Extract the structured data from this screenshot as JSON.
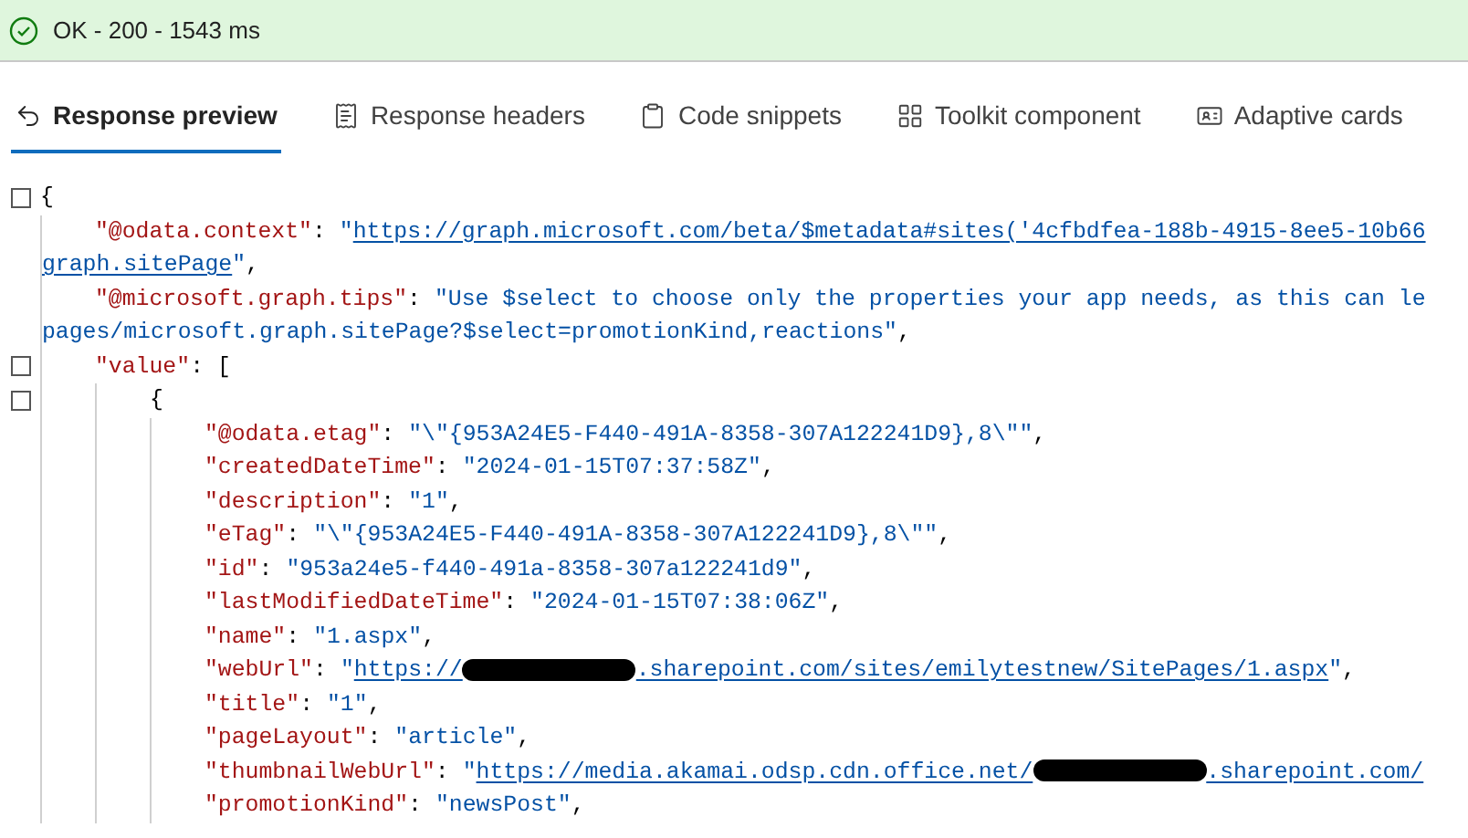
{
  "status": {
    "kind": "success",
    "text": "OK - 200 - 1543 ms"
  },
  "tabs": [
    {
      "label": "Response preview",
      "selected": true
    },
    {
      "label": "Response headers",
      "selected": false
    },
    {
      "label": "Code snippets",
      "selected": false
    },
    {
      "label": "Toolkit component",
      "selected": false
    },
    {
      "label": "Adaptive cards",
      "selected": false
    }
  ],
  "response": {
    "open": "{",
    "collapsible": true,
    "children": [
      {
        "key": "\"@odata.context\"",
        "sep": ":",
        "value": [
          {
            "kind": "string",
            "text": "\""
          },
          {
            "kind": "link",
            "parts": [
              {
                "kind": "text",
                "text": "https://graph.microsoft.com/beta/$metadata#sites('4cfbdfea-188b-4915-8ee5-10b66"
              }
            ]
          }
        ],
        "wrap": [
          {
            "kind": "link",
            "parts": [
              {
                "kind": "text",
                "text": "graph.sitePage"
              }
            ]
          },
          {
            "kind": "string",
            "text": "\""
          },
          {
            "kind": "punct",
            "text": ","
          }
        ]
      },
      {
        "key": "\"@microsoft.graph.tips\"",
        "sep": ":",
        "value": [
          {
            "kind": "string",
            "text": "\"Use $select to choose only the properties your app needs, as this can le"
          }
        ],
        "wrap": [
          {
            "kind": "string",
            "text": "pages/microsoft.graph.sitePage?$select=promotionKind,reactions\""
          },
          {
            "kind": "punct",
            "text": ","
          }
        ]
      },
      {
        "key": "\"value\"",
        "sep": ":",
        "open": "[",
        "collapsible": true,
        "children": [
          {
            "open": "{",
            "collapsible": true,
            "children": [
              {
                "key": "\"@odata.etag\"",
                "sep": ":",
                "value": [
                  {
                    "kind": "string",
                    "text": "\"\\\"{953A24E5-F440-491A-8358-307A122241D9},8\\\"\""
                  },
                  {
                    "kind": "punct",
                    "text": ","
                  }
                ]
              },
              {
                "key": "\"createdDateTime\"",
                "sep": ":",
                "value": [
                  {
                    "kind": "string",
                    "text": "\"2024-01-15T07:37:58Z\""
                  },
                  {
                    "kind": "punct",
                    "text": ","
                  }
                ]
              },
              {
                "key": "\"description\"",
                "sep": ":",
                "value": [
                  {
                    "kind": "string",
                    "text": "\"1\""
                  },
                  {
                    "kind": "punct",
                    "text": ","
                  }
                ]
              },
              {
                "key": "\"eTag\"",
                "sep": ":",
                "value": [
                  {
                    "kind": "string",
                    "text": "\"\\\"{953A24E5-F440-491A-8358-307A122241D9},8\\\"\""
                  },
                  {
                    "kind": "punct",
                    "text": ","
                  }
                ]
              },
              {
                "key": "\"id\"",
                "sep": ":",
                "value": [
                  {
                    "kind": "string",
                    "text": "\"953a24e5-f440-491a-8358-307a122241d9\""
                  },
                  {
                    "kind": "punct",
                    "text": ","
                  }
                ]
              },
              {
                "key": "\"lastModifiedDateTime\"",
                "sep": ":",
                "value": [
                  {
                    "kind": "string",
                    "text": "\"2024-01-15T07:38:06Z\""
                  },
                  {
                    "kind": "punct",
                    "text": ","
                  }
                ]
              },
              {
                "key": "\"name\"",
                "sep": ":",
                "value": [
                  {
                    "kind": "string",
                    "text": "\"1.aspx\""
                  },
                  {
                    "kind": "punct",
                    "text": ","
                  }
                ]
              },
              {
                "key": "\"webUrl\"",
                "sep": ":",
                "value": [
                  {
                    "kind": "string",
                    "text": "\""
                  },
                  {
                    "kind": "link",
                    "parts": [
                      {
                        "kind": "text",
                        "text": "https://"
                      },
                      {
                        "kind": "redacted"
                      },
                      {
                        "kind": "text",
                        "text": ".sharepoint.com/sites/emilytestnew/SitePages/1.aspx"
                      }
                    ]
                  },
                  {
                    "kind": "string",
                    "text": "\""
                  },
                  {
                    "kind": "punct",
                    "text": ","
                  }
                ]
              },
              {
                "key": "\"title\"",
                "sep": ":",
                "value": [
                  {
                    "kind": "string",
                    "text": "\"1\""
                  },
                  {
                    "kind": "punct",
                    "text": ","
                  }
                ]
              },
              {
                "key": "\"pageLayout\"",
                "sep": ":",
                "value": [
                  {
                    "kind": "string",
                    "text": "\"article\""
                  },
                  {
                    "kind": "punct",
                    "text": ","
                  }
                ]
              },
              {
                "key": "\"thumbnailWebUrl\"",
                "sep": ":",
                "value": [
                  {
                    "kind": "string",
                    "text": "\""
                  },
                  {
                    "kind": "link",
                    "parts": [
                      {
                        "kind": "text",
                        "text": "https://media.akamai.odsp.cdn.office.net/"
                      },
                      {
                        "kind": "redacted"
                      },
                      {
                        "kind": "text",
                        "text": ".sharepoint.com/"
                      }
                    ]
                  }
                ]
              },
              {
                "key": "\"promotionKind\"",
                "sep": ":",
                "value": [
                  {
                    "kind": "string",
                    "text": "\"newsPost\""
                  },
                  {
                    "kind": "punct",
                    "text": ","
                  }
                ]
              }
            ]
          }
        ]
      }
    ]
  }
}
